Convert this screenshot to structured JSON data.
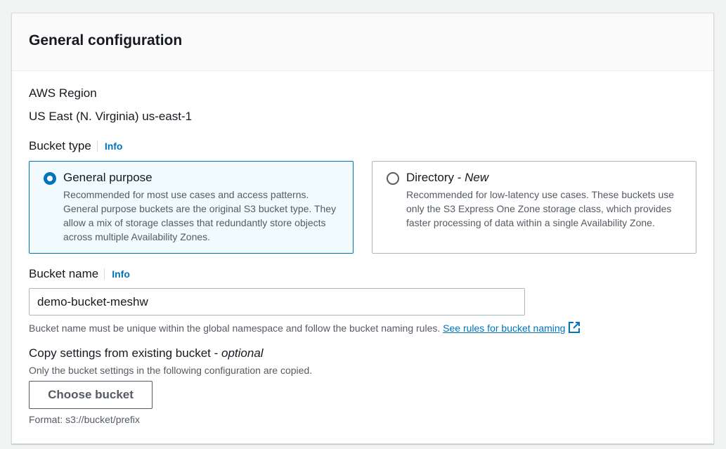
{
  "panel": {
    "title": "General configuration"
  },
  "region": {
    "label": "AWS Region",
    "value": "US East (N. Virginia) us-east-1"
  },
  "bucket_type": {
    "label": "Bucket type",
    "info": "Info",
    "options": [
      {
        "title": "General purpose",
        "title_suffix": "",
        "description": "Recommended for most use cases and access patterns. General purpose buckets are the original S3 bucket type. They allow a mix of storage classes that redundantly store objects across multiple Availability Zones.",
        "selected": true
      },
      {
        "title": "Directory - ",
        "title_suffix": "New",
        "description": "Recommended for low-latency use cases. These buckets use only the S3 Express One Zone storage class, which provides faster processing of data within a single Availability Zone.",
        "selected": false
      }
    ]
  },
  "bucket_name": {
    "label": "Bucket name",
    "info": "Info",
    "value": "demo-bucket-meshw",
    "hint": "Bucket name must be unique within the global namespace and follow the bucket naming rules.",
    "rules_link": "See rules for bucket naming"
  },
  "copy_settings": {
    "label": "Copy settings from existing bucket - ",
    "label_optional": "optional",
    "description": "Only the bucket settings in the following configuration are copied.",
    "button": "Choose bucket",
    "format_hint": "Format: s3://bucket/prefix"
  },
  "colors": {
    "accent": "#0073bb",
    "selected_tile_bg": "#f1faff",
    "text": "#16191f",
    "secondary_text": "#545b64"
  }
}
